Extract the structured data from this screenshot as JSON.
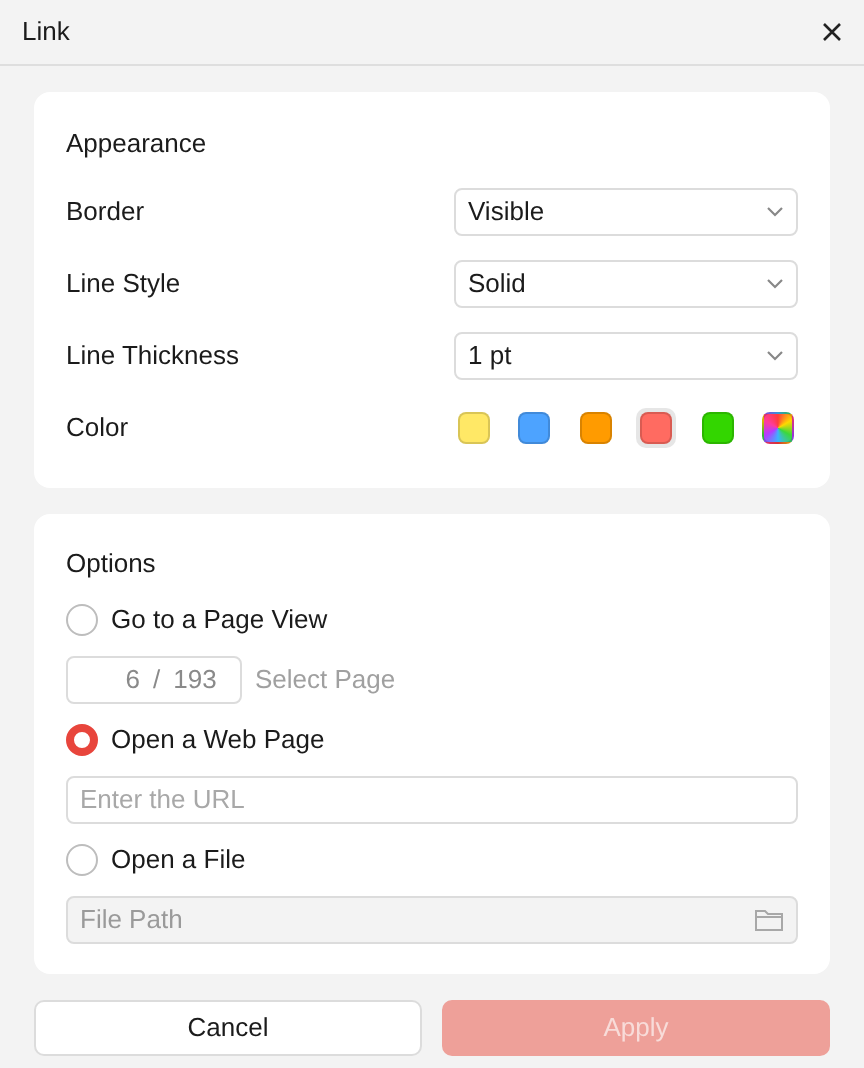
{
  "window": {
    "title": "Link"
  },
  "appearance": {
    "heading": "Appearance",
    "fields": [
      {
        "label": "Border",
        "value": "Visible"
      },
      {
        "label": "Line Style",
        "value": "Solid"
      },
      {
        "label": "Line Thickness",
        "value": "1 pt"
      }
    ],
    "color": {
      "label": "Color",
      "swatches": [
        {
          "kind": "solid",
          "color": "#ffe866",
          "selected": false
        },
        {
          "kind": "solid",
          "color": "#4da3ff",
          "selected": false
        },
        {
          "kind": "solid",
          "color": "#ff9b00",
          "selected": false
        },
        {
          "kind": "solid",
          "color": "#ff6b61",
          "selected": true
        },
        {
          "kind": "solid",
          "color": "#33d600",
          "selected": false
        },
        {
          "kind": "spectrum",
          "selected": false
        }
      ]
    }
  },
  "options": {
    "heading": "Options",
    "choices": [
      {
        "kind": "page",
        "label": "Go to a Page View",
        "selected": false,
        "page": "6",
        "separator": "/",
        "total": "193",
        "hint": "Select Page"
      },
      {
        "kind": "url",
        "label": "Open a Web Page",
        "selected": true,
        "placeholder": "Enter the URL"
      },
      {
        "kind": "file",
        "label": "Open a File",
        "selected": false,
        "placeholder": "File Path",
        "disabled": true
      }
    ]
  },
  "buttons": [
    {
      "kind": "secondary",
      "label": "Cancel",
      "disabled": false
    },
    {
      "kind": "primary",
      "label": "Apply",
      "disabled": true
    }
  ]
}
